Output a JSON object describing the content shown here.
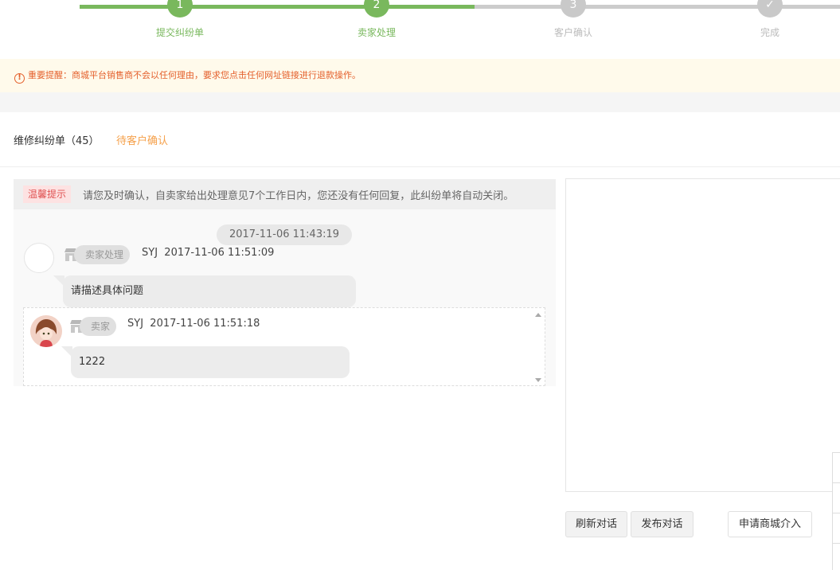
{
  "steps": [
    {
      "num": "1",
      "label": "提交纠纷单",
      "state": "done"
    },
    {
      "num": "2",
      "label": "卖家处理",
      "state": "done"
    },
    {
      "num": "3",
      "label": "客户确认",
      "state": "todo"
    },
    {
      "num": "✓",
      "label": "完成",
      "state": "todo"
    }
  ],
  "warning": {
    "icon": "!",
    "text": "重要提醒：商城平台销售商不会以任何理由，要求您点击任何网址链接进行退款操作。"
  },
  "order": {
    "title": "维修纠纷单（45）",
    "status": "待客户确认"
  },
  "tip": {
    "badge": "温馨提示",
    "text": "请您及时确认，自卖家给出处理意见7个工作日内，您还没有任何回复，此纠纷单将自动关闭。"
  },
  "conversation": {
    "time_divider": "2017-11-06 11:43:19",
    "messages": [
      {
        "role": "卖家处理",
        "user": "SYJ",
        "time": "2017-11-06 11:51:09",
        "text": "请描述具体问题"
      },
      {
        "role": "卖家",
        "user": "SYJ",
        "time": "2017-11-06 11:51:18",
        "text": "1222"
      }
    ]
  },
  "buttons": {
    "refresh": "刷新对话",
    "publish": "发布对话",
    "apply": "申请商城介入"
  },
  "colors": {
    "accent_green": "#79b85d",
    "warning": "#e4602c",
    "status_orange": "#f5a04a"
  },
  "icons": [
    "warning-icon",
    "shop-icon",
    "checkmark-icon",
    "avatar",
    "scroll-up-icon",
    "scroll-down-icon"
  ]
}
